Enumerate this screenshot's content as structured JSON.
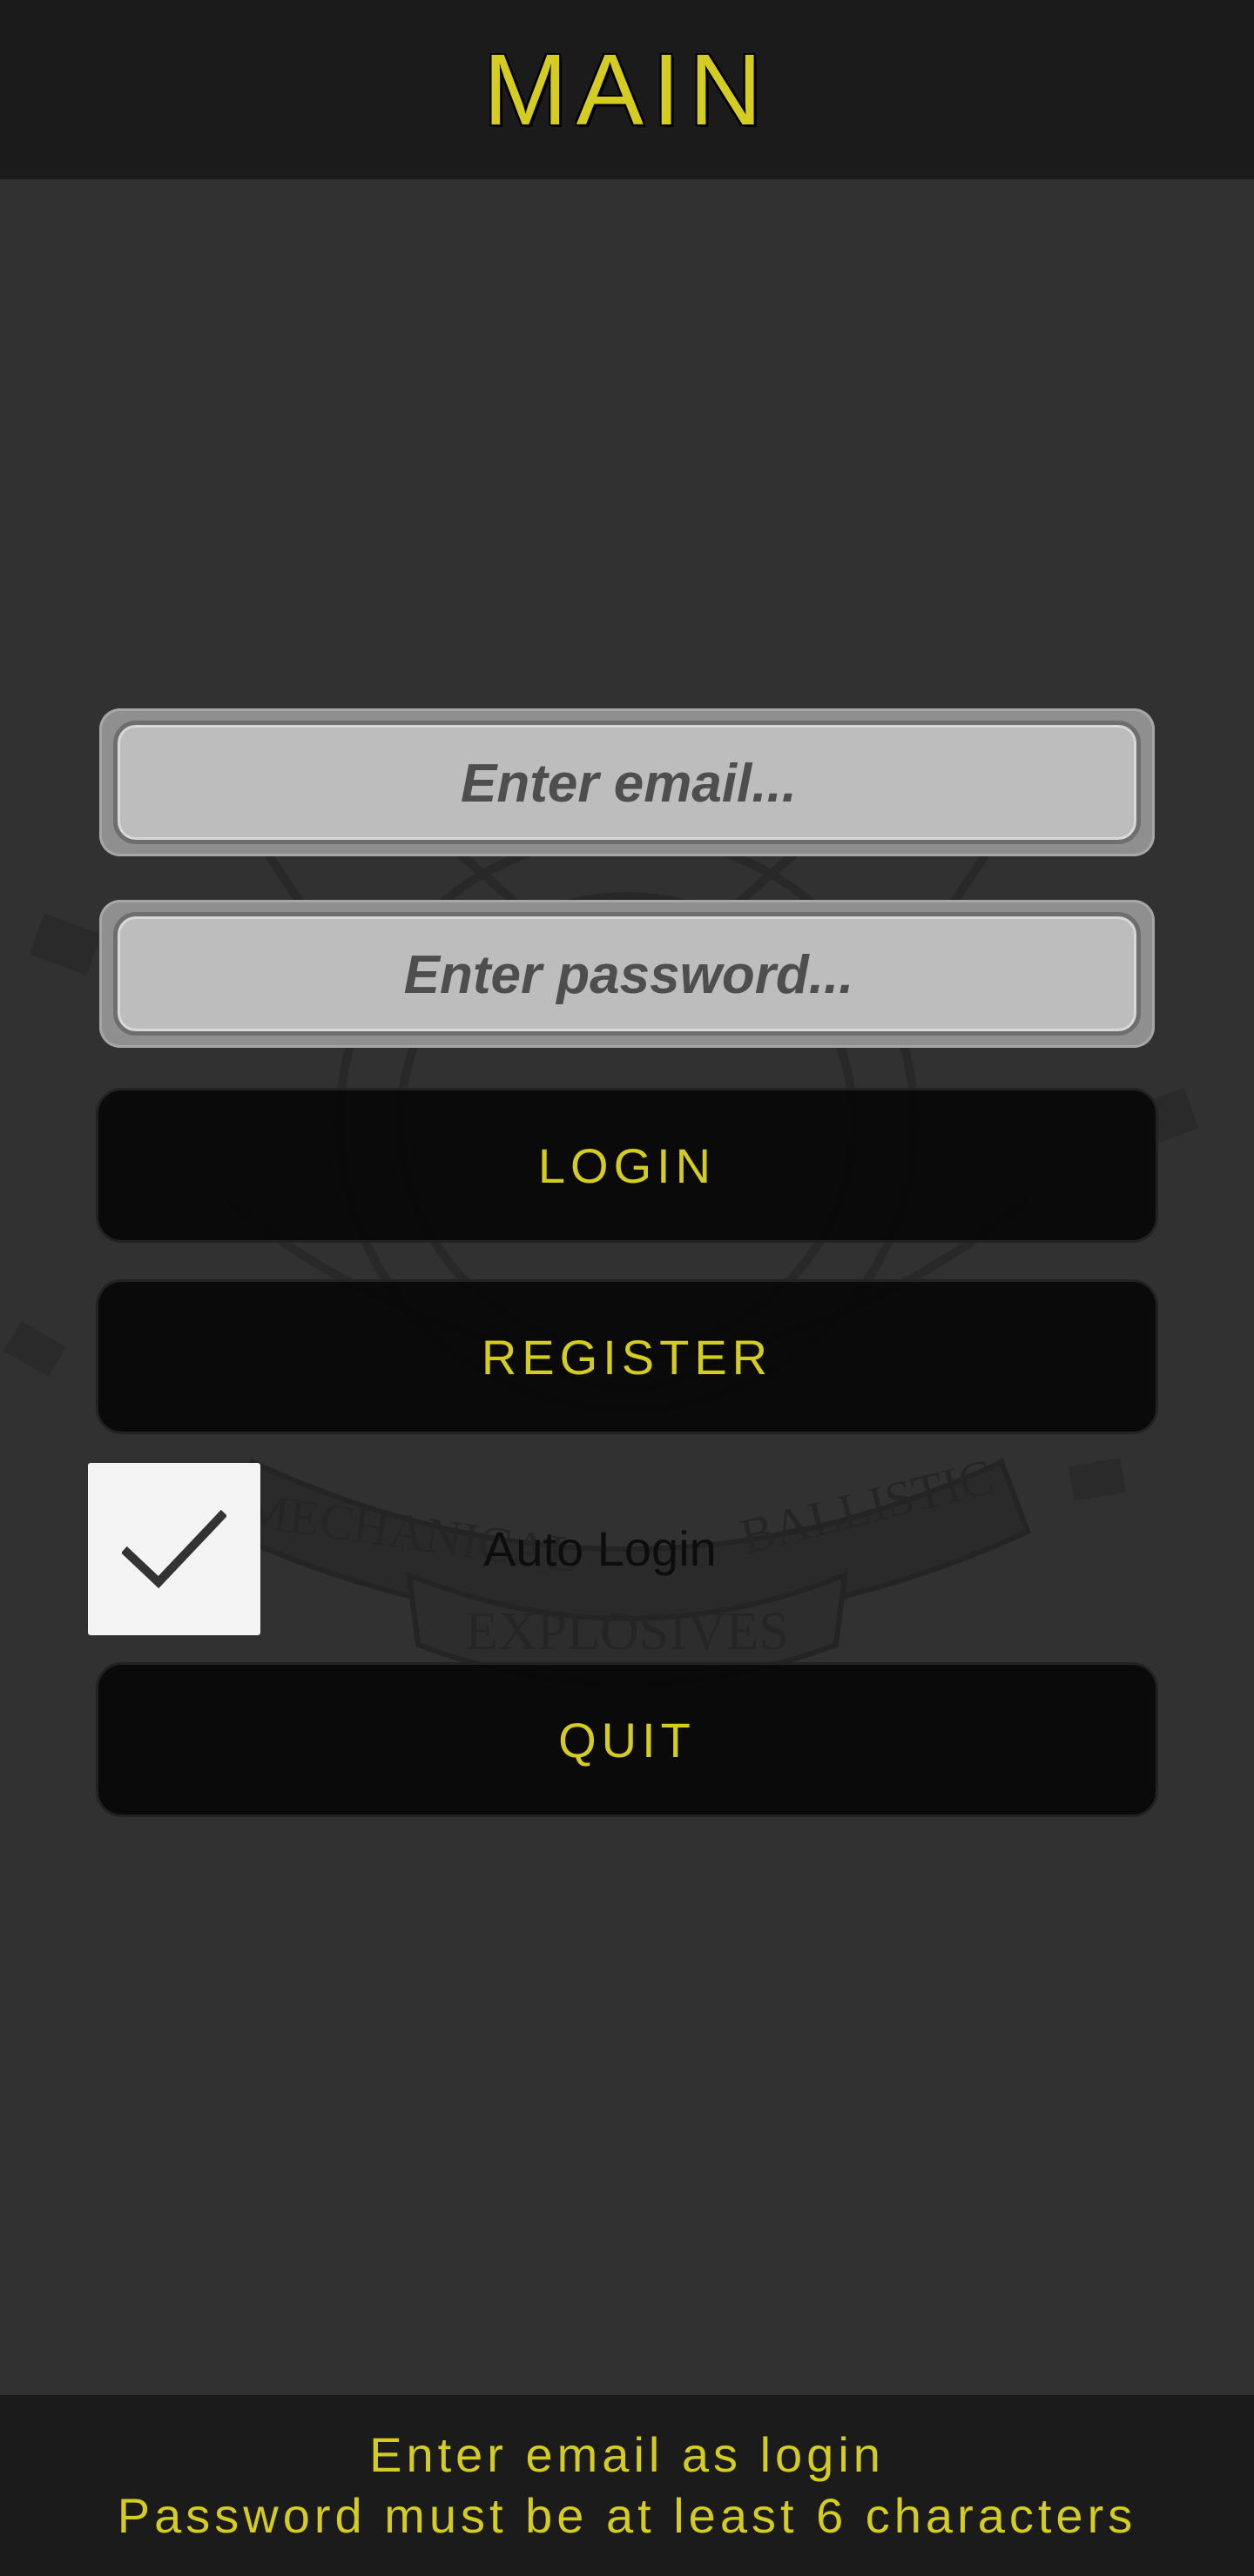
{
  "header": {
    "title": "MAIN"
  },
  "form": {
    "email_placeholder": "Enter email...",
    "password_placeholder": "Enter password...",
    "login_label": "LOGIN",
    "register_label": "REGISTER",
    "auto_login_label": "Auto Login",
    "auto_login_checked": true,
    "quit_label": "QUIT"
  },
  "footer": {
    "line1": "Enter email as login",
    "line2": "Password must be at least 6 characters"
  },
  "background": {
    "emblem_text_left": "MECHANICAL",
    "emblem_text_right": "BALLISTIC",
    "emblem_text_bottom": "EXPLOSIVES"
  },
  "colors": {
    "accent": "#d4cc22",
    "background": "#313131",
    "bar": "#1b1b1b"
  }
}
